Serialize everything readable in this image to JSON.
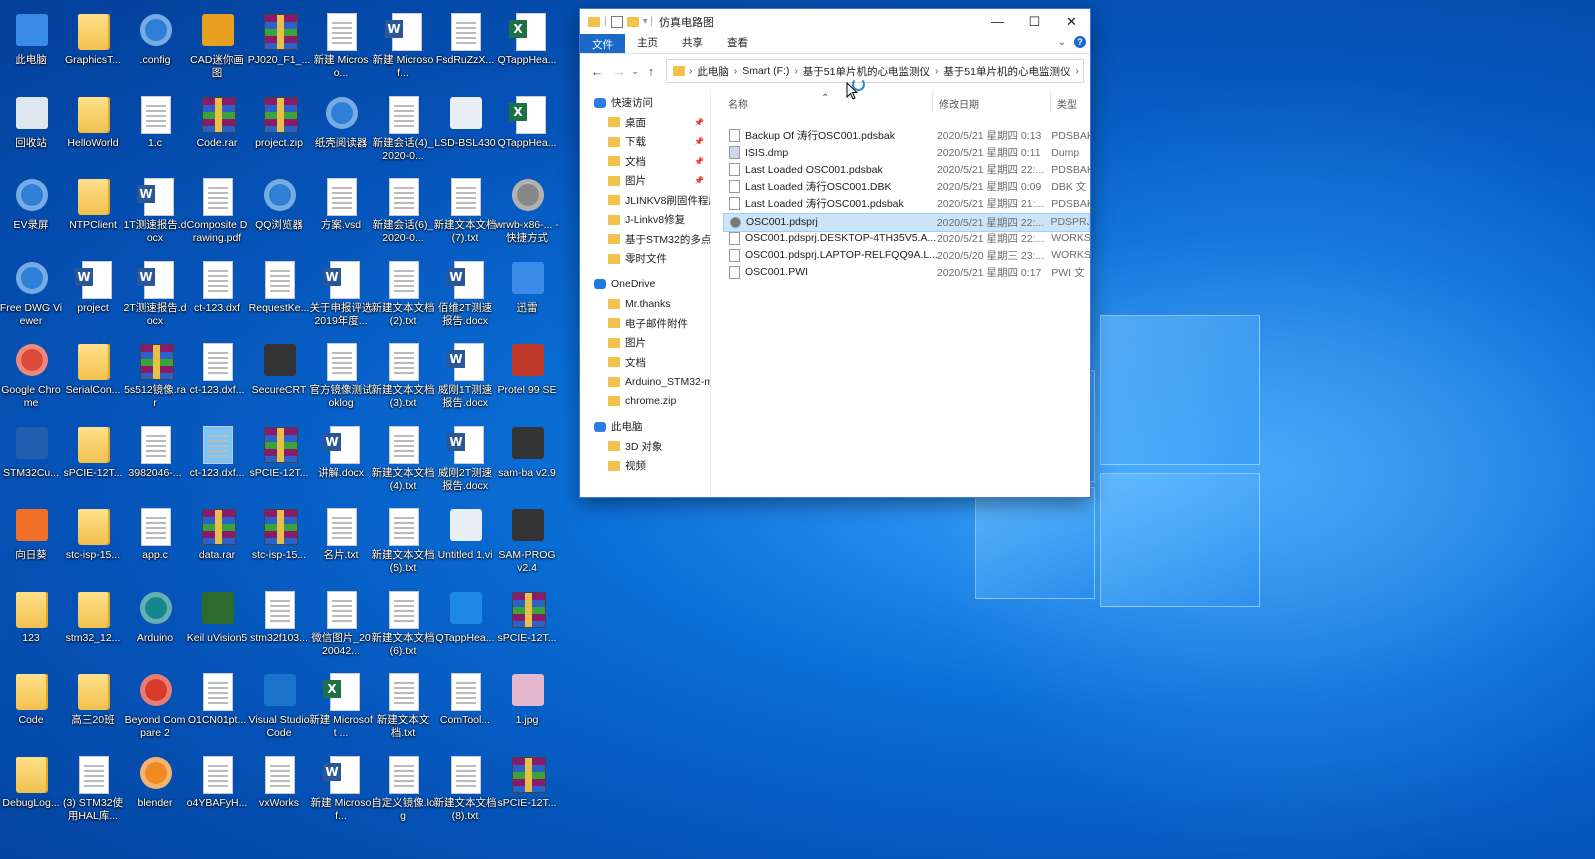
{
  "desktop": {
    "icons": [
      [
        "此电脑",
        "GraphicsT...",
        ".config",
        "CAD迷你画图",
        "PJ020_F1_...",
        "新建 Microso...",
        "新建 Microsof...",
        "FsdRuZzX...",
        "QTappHea..."
      ],
      [
        "回收站",
        "HelloWorld",
        "1.c",
        "Code.rar",
        "project.zip",
        "纸壳阅读器",
        "新建会话(4)_2020-0...",
        "LSD-BSL430",
        "QTappHea..."
      ],
      [
        "EV录屏",
        "NTPClient",
        "1T测速报告.docx",
        "Composite Drawing.pdf",
        "QQ浏览器",
        "方案.vsd",
        "新建会话(6)_2020-0...",
        "新建文本文档(7).txt",
        "wrwb-x86-... - 快捷方式"
      ],
      [
        "Free DWG Viewer",
        "project",
        "2T测速报告.docx",
        "ct-123.dxf",
        "RequestKe...",
        "关于申报评选2019年度...",
        "新建文本文档(2).txt",
        "佰维2T测速报告.docx",
        "迅雷"
      ],
      [
        "Google Chrome",
        "SerialCon...",
        "5s512镜像.rar",
        "ct-123.dxf...",
        "SecureCRT",
        "官方镜像测试oklog",
        "新建文本文档(3).txt",
        "威刚1T测速报告.docx",
        "Protel 99 SE"
      ],
      [
        "STM32Cu...",
        "sPCIE-12T...",
        "3982046-...",
        "ct-123.dxf...",
        "sPCIE-12T...",
        "讲解.docx",
        "新建文本文档(4).txt",
        "威刚2T测速报告.docx",
        "sam-ba v2.9"
      ],
      [
        "向日葵",
        "stc-isp-15...",
        "app.c",
        "data.rar",
        "stc-isp-15...",
        "名片.txt",
        "新建文本文档(5).txt",
        "Untitled 1.vi",
        "SAM-PROG v2.4"
      ],
      [
        "123",
        "stm32_12...",
        "Arduino",
        "Keil uVision5",
        "stm32f103...",
        "微信图片_2020042...",
        "新建文本文档(6).txt",
        "QTappHea...",
        "sPCIE-12T..."
      ],
      [
        "Code",
        "高三20班",
        "Beyond Compare 2",
        "O1CN01pt...",
        "Visual Studio Code",
        "新建 Microsoft ...",
        "新建文本文档.txt",
        "ComTool...",
        "1.jpg"
      ],
      [
        "DebugLog...",
        "(3) STM32使用HAL库...",
        "blender",
        "o4YBAFyH...",
        "vxWorks",
        "新建 Microsof...",
        "自定义镜像.log",
        "新建文本文档(8).txt",
        "sPCIE-12T..."
      ]
    ]
  },
  "explorer": {
    "title": "仿真电路图",
    "ribbon_tabs": [
      "文件",
      "主页",
      "共享",
      "查看"
    ],
    "address": [
      "此电脑",
      "Smart (F:)",
      "基于51单片机的心电监测仪",
      "基于51单片机的心电监测仪"
    ],
    "nav": [
      {
        "label": "快速访问",
        "level": 0
      },
      {
        "label": "桌面",
        "level": 1,
        "pinned": true
      },
      {
        "label": "下载",
        "level": 1,
        "pinned": true
      },
      {
        "label": "文档",
        "level": 1,
        "pinned": true
      },
      {
        "label": "图片",
        "level": 1,
        "pinned": true
      },
      {
        "label": "JLINKV8刷固件程序",
        "level": 1
      },
      {
        "label": "J-Linkv8修复",
        "level": 1
      },
      {
        "label": "基于STM32的多点d",
        "level": 1
      },
      {
        "label": "零时文件",
        "level": 1
      },
      {
        "label": "OneDrive",
        "level": 0
      },
      {
        "label": "Mr.thanks",
        "level": 1
      },
      {
        "label": "电子邮件附件",
        "level": 1
      },
      {
        "label": "图片",
        "level": 1
      },
      {
        "label": "文档",
        "level": 1
      },
      {
        "label": "Arduino_STM32-m",
        "level": 1
      },
      {
        "label": "chrome.zip",
        "level": 1
      },
      {
        "label": "此电脑",
        "level": 0
      },
      {
        "label": "3D 对象",
        "level": 1
      },
      {
        "label": "视频",
        "level": 1
      }
    ],
    "columns": {
      "name": "名称",
      "date": "修改日期",
      "type": "类型"
    },
    "files": [
      {
        "name": "Backup Of 涛行OSC001.pdsbak",
        "date": "2020/5/21 星期四 0:13",
        "type": "PDSBAK"
      },
      {
        "name": "ISIS.dmp",
        "date": "2020/5/21 星期四 0:11",
        "type": "Dump"
      },
      {
        "name": "Last Loaded OSC001.pdsbak",
        "date": "2020/5/21 星期四 22:...",
        "type": "PDSBAK"
      },
      {
        "name": "Last Loaded 涛行OSC001.DBK",
        "date": "2020/5/21 星期四 0:09",
        "type": "DBK 文"
      },
      {
        "name": "Last Loaded 涛行OSC001.pdsbak",
        "date": "2020/5/21 星期四 21:...",
        "type": "PDSBAK"
      },
      {
        "name": "OSC001.pdsprj",
        "date": "2020/5/21 星期四 22:...",
        "type": "PDSPRJ",
        "selected": true
      },
      {
        "name": "OSC001.pdsprj.DESKTOP-4TH35V5.A...",
        "date": "2020/5/21 星期四 22:...",
        "type": "WORKS"
      },
      {
        "name": "OSC001.pdsprj.LAPTOP-RELFQQ9A.L...",
        "date": "2020/5/20 星期三 23:...",
        "type": "WORKS"
      },
      {
        "name": "OSC001.PWI",
        "date": "2020/5/21 星期四 0:17",
        "type": "PWI 文"
      }
    ]
  }
}
